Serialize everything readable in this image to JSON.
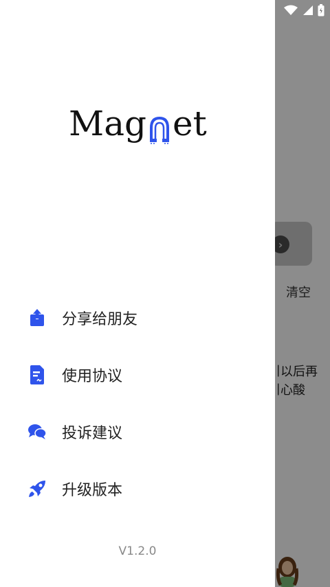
{
  "brand": {
    "logo_text_left": "Mag",
    "logo_text_right": "et"
  },
  "menu": {
    "items": [
      {
        "label": "分享给朋友",
        "icon": "share-icon"
      },
      {
        "label": "使用协议",
        "icon": "document-icon"
      },
      {
        "label": "投诉建议",
        "icon": "chat-bubbles-icon"
      },
      {
        "label": "升级版本",
        "icon": "rocket-icon"
      }
    ]
  },
  "version": "V1.2.0",
  "background": {
    "clear_label": "清空",
    "text_line1": "引以后再",
    "text_line2": "引心酸"
  },
  "colors": {
    "accent": "#2f54eb",
    "scrim": "#000000"
  }
}
